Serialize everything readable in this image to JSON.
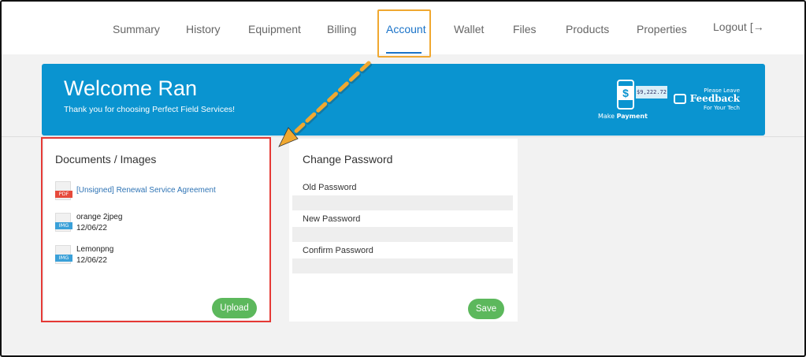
{
  "nav": {
    "items": [
      "Summary",
      "History",
      "Equipment",
      "Billing",
      "Account",
      "Wallet",
      "Files",
      "Products",
      "Properties"
    ],
    "active": "Account",
    "logout_label": "Logout",
    "logout_icon": "logout-arrow-icon"
  },
  "banner": {
    "welcome": "Welcome Ran",
    "subtitle": "Thank you for choosing Perfect Field Services!",
    "payment": {
      "amount": "$9,222.72",
      "make_label": "Make ",
      "payment_label": "Payment"
    },
    "feedback": {
      "top": "Please Leave",
      "main": "Feedback",
      "bottom": "For Your Tech"
    }
  },
  "documents": {
    "title": "Documents / Images",
    "items": [
      {
        "type": "PDF",
        "name": "[Unsigned] Renewal Service Agreement",
        "date": ""
      },
      {
        "type": "IMG",
        "name": "orange 2jpeg",
        "date": "12/06/22"
      },
      {
        "type": "IMG",
        "name": "Lemonpng",
        "date": "12/06/22"
      }
    ],
    "upload_label": "Upload"
  },
  "password": {
    "title": "Change Password",
    "old_label": "Old Password",
    "new_label": "New Password",
    "confirm_label": "Confirm Password",
    "save_label": "Save"
  },
  "colors": {
    "banner": "#0a94d0",
    "active_nav": "#1a73c8",
    "button_green": "#5cb85c",
    "annotation_orange": "#f0a830",
    "annotation_red": "#e53935"
  }
}
